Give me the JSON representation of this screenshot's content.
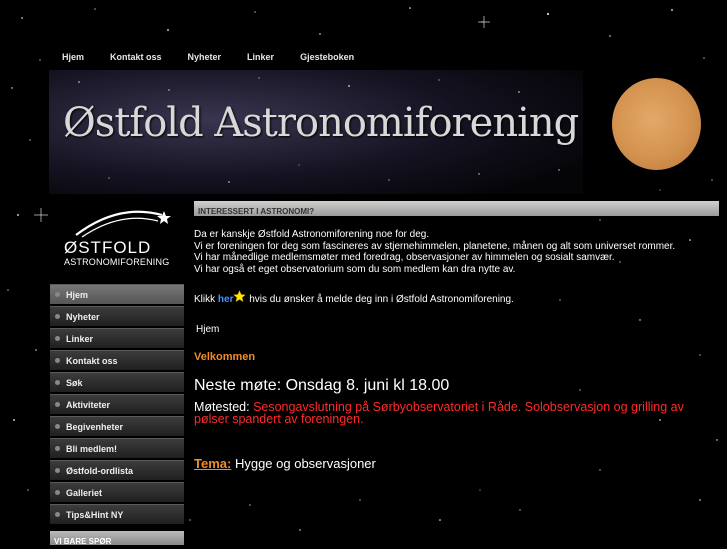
{
  "topnav": [
    "Hjem",
    "Kontakt oss",
    "Nyheter",
    "Linker",
    "Gjesteboken"
  ],
  "banner": {
    "title": "Østfold Astronomiforening"
  },
  "logo": {
    "line1": "ØSTFOLD",
    "line2": "ASTRONOMIFORENING"
  },
  "sidenav": [
    "Hjem",
    "Nyheter",
    "Linker",
    "Kontakt oss",
    "Søk",
    "Aktiviteter",
    "Begivenheter",
    "Bli medlem!",
    "Østfold-ordlista",
    "Galleriet",
    "Tips&Hint NY"
  ],
  "sidebar_box": {
    "title": "VI BARE SPØR"
  },
  "main": {
    "section_header": "INTERESSERT I ASTRONOMI?",
    "intro": [
      "Da er kanskje Østfold Astronomiforening noe for deg.",
      "Vi er foreningen for deg som fascineres av stjernehimmelen, planetene, månen og alt som universet rommer.",
      "Vi har månedlige medlemsmøter med foredrag, observasjoner av himmelen og sosialt samvær.",
      "Vi har også et eget observatorium som du som medlem kan dra nytte av."
    ],
    "klikk_pre": "Klikk",
    "klikk_link": "her",
    "klikk_post": "hvis du ønsker å melde deg inn i Østfold Astronomiforening.",
    "hjem": "Hjem",
    "velkommen": "Velkommen",
    "neste_mote": "Neste møte: Onsdag 8. juni kl 18.00",
    "motested_label": "Møtested:",
    "motested_value": "Sesongavslutning på Sørbyobservatoriet i Råde. Solobservasjon og grilling av pølser spandert av foreningen.",
    "tema_label": "Tema:",
    "tema_value": "Hygge og observasjoner"
  },
  "colors": {
    "accent_orange": "#f28c28",
    "link_blue": "#4a90ff",
    "red_text": "#ff2a2a"
  }
}
